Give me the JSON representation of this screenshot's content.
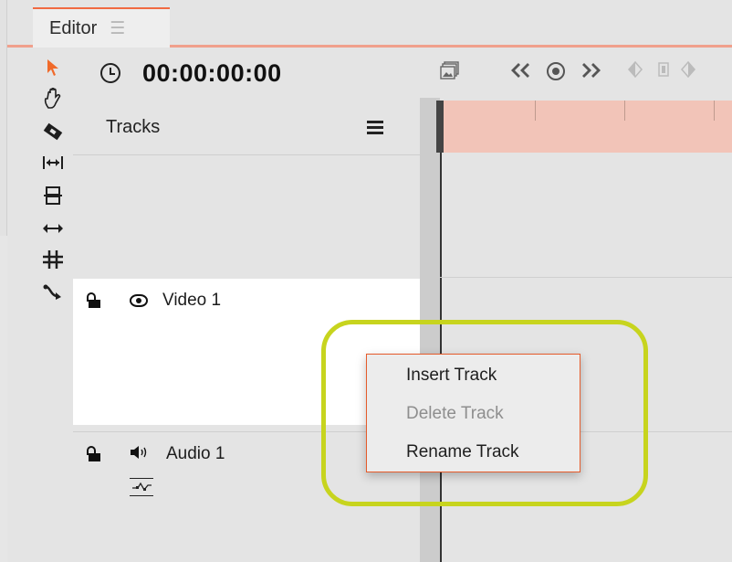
{
  "tab": {
    "label": "Editor",
    "menu_icon": "hamburger-icon"
  },
  "tools": [
    {
      "name": "select-tool",
      "glyph": "➤",
      "color": "#f06a2a",
      "active": true
    },
    {
      "name": "hand-tool",
      "glyph": "✋",
      "color": "#1e1e1e",
      "active": false
    },
    {
      "name": "razor-tool",
      "glyph": "◆",
      "color": "#1e1e1e",
      "active": false
    },
    {
      "name": "ripple-tool",
      "glyph": "⇹",
      "color": "#1e1e1e",
      "active": false
    },
    {
      "name": "roll-tool",
      "glyph": "⇳",
      "color": "#1e1e1e",
      "active": false
    },
    {
      "name": "slip-tool",
      "glyph": "↔",
      "color": "#1e1e1e",
      "active": false
    },
    {
      "name": "slide-tool",
      "glyph": "⌗",
      "color": "#1e1e1e",
      "active": false
    },
    {
      "name": "curve-tool",
      "glyph": "⤷",
      "color": "#1e1e1e",
      "active": false
    }
  ],
  "timecode": "00:00:00:00",
  "tracks_header": {
    "label": "Tracks"
  },
  "tracks": [
    {
      "type": "video",
      "name": "Video 1",
      "locked": false,
      "visible": true
    },
    {
      "type": "audio",
      "name": "Audio 1",
      "locked": false,
      "muted": false
    }
  ],
  "context_menu": {
    "items": [
      {
        "label": "Insert Track",
        "enabled": true
      },
      {
        "label": "Delete Track",
        "enabled": false
      },
      {
        "label": "Rename Track",
        "enabled": true
      }
    ]
  },
  "colors": {
    "accent": "#f06a42",
    "ruler": "#f2c4b8",
    "highlight": "#c7d41e",
    "menu_border": "#e55b2b"
  }
}
